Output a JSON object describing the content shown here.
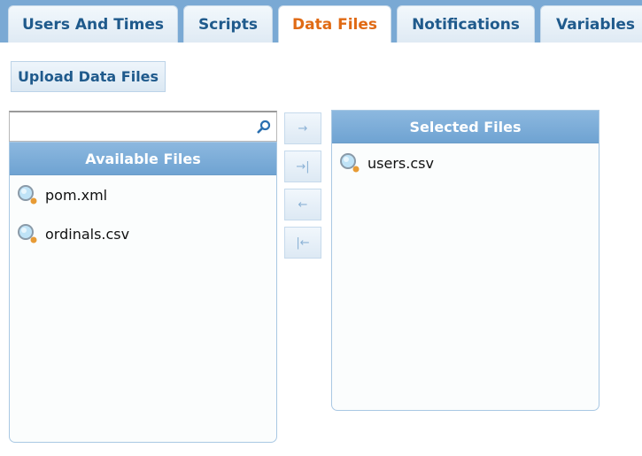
{
  "tabs": [
    {
      "label": "Users And Times",
      "active": false
    },
    {
      "label": "Scripts",
      "active": false
    },
    {
      "label": "Data Files",
      "active": true
    },
    {
      "label": "Notifications",
      "active": false
    },
    {
      "label": "Variables",
      "active": false
    }
  ],
  "upload_button": "Upload Data Files",
  "search": {
    "value": "",
    "placeholder": "",
    "icon": "search-icon"
  },
  "available": {
    "title": "Available Files",
    "files": [
      {
        "name": "pom.xml",
        "icon": "magnifier-icon"
      },
      {
        "name": "ordinals.csv",
        "icon": "magnifier-icon"
      }
    ]
  },
  "selected": {
    "title": "Selected Files",
    "files": [
      {
        "name": "users.csv",
        "icon": "magnifier-icon"
      }
    ]
  },
  "move_buttons": {
    "add": "→",
    "add_all": "→|",
    "remove": "←",
    "remove_all": "|←"
  },
  "colors": {
    "tab_active": "#e06a14",
    "tab_text": "#1f5a8c",
    "header_bg": "#7aa9d4"
  }
}
